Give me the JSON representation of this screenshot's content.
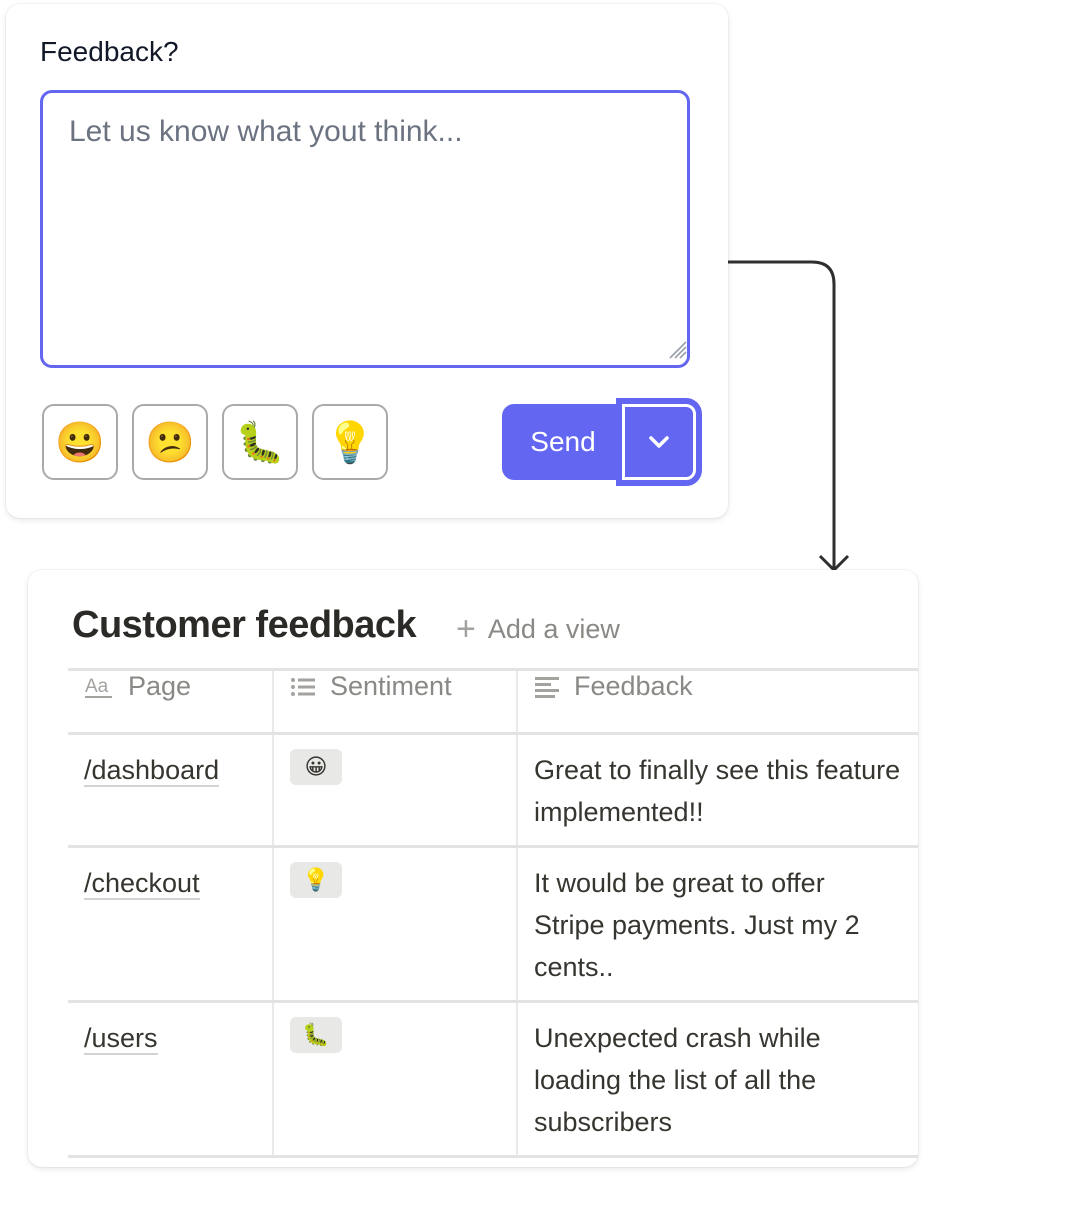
{
  "feedback_widget": {
    "label": "Feedback?",
    "textarea": {
      "value": "",
      "placeholder": "Let us know what yout think..."
    },
    "emoji_buttons": [
      {
        "name": "happy",
        "emoji": "😀"
      },
      {
        "name": "confused",
        "emoji": "😕"
      },
      {
        "name": "bug",
        "emoji": "🐛"
      },
      {
        "name": "idea",
        "emoji": "💡"
      }
    ],
    "send_label": "Send",
    "accent_color": "#6366f1"
  },
  "database": {
    "title": "Customer feedback",
    "add_view_label": "Add a view",
    "columns": [
      {
        "label": "Page",
        "icon": "text-property-icon"
      },
      {
        "label": "Sentiment",
        "icon": "list-property-icon"
      },
      {
        "label": "Feedback",
        "icon": "text-lines-icon"
      }
    ],
    "rows": [
      {
        "page": "/dashboard",
        "sentiment": "😀",
        "feedback": "Great to finally see this feature implemented!!"
      },
      {
        "page": "/checkout",
        "sentiment": "💡",
        "feedback": "It would be great to offer Stripe payments. Just my 2 cents.."
      },
      {
        "page": "/users",
        "sentiment": "🐛",
        "feedback": "Unexpected crash while loading the list of all the subscribers"
      }
    ]
  }
}
